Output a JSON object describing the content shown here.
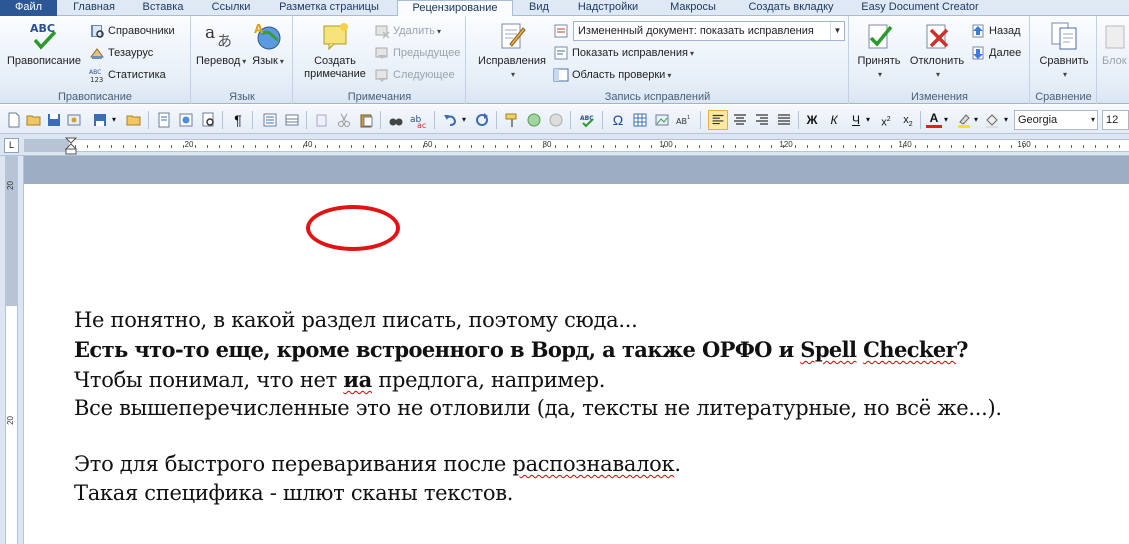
{
  "tabs": [
    "Файл",
    "Главная",
    "Вставка",
    "Ссылки",
    "Разметка страницы",
    "Рецензирование",
    "Вид",
    "Надстройки",
    "Макросы",
    "Создать вкладку",
    "Easy Document Creator"
  ],
  "ribbon": {
    "proofing": {
      "name": "Правописание",
      "spelling": "Правописание",
      "research": "Справочники",
      "thesaurus": "Тезаурус",
      "statistics": "Статистика"
    },
    "language": {
      "name": "Язык",
      "translate": "Перевод",
      "language": "Язык"
    },
    "comments": {
      "name": "Примечания",
      "new_comment": "Создать примечание",
      "new_comment_line1": "Создать",
      "new_comment_line2": "примечание",
      "delete": "Удалить",
      "previous": "Предыдущее",
      "next": "Следующее"
    },
    "tracking": {
      "name": "Запись исправлений",
      "track_changes": "Исправления",
      "display_mode": "Измененный документ: показать исправления",
      "show_markup": "Показать исправления",
      "reviewing_pane": "Область проверки"
    },
    "changes": {
      "name": "Изменения",
      "accept": "Принять",
      "reject": "Отклонить",
      "previous": "Назад",
      "next": "Далее"
    },
    "compare": {
      "name": "Сравнение",
      "compare": "Сравнить"
    },
    "protect": {
      "block_cut": "Блок"
    }
  },
  "toolbar": {
    "font_name": "Georgia",
    "font_size": "12",
    "bold": "Ж",
    "italic": "К",
    "underline": "Ч",
    "omega": "Ω",
    "pilcrow": "¶"
  },
  "ruler": {
    "h_labels": [
      "20",
      "40",
      "60",
      "80",
      "100",
      "120",
      "140",
      "160"
    ],
    "v_labels": [
      "20",
      "20"
    ]
  },
  "document": {
    "line1": "Не понятно, в какой раздел писать, поэтому сюда...",
    "line2_a": "Есть что-то еще, кроме встроенного в Ворд, а также ОРФО и ",
    "line2_b": "Spell",
    "line2_c": " ",
    "line2_d": "Checker",
    "line2_e": "?",
    "line3_a": "Чтобы понимал, что нет ",
    "line3_b": "иа",
    "line3_c": " предлога, например.",
    "line4": "Все вышеперечисленные это не отловили (да, тексты не литературные, но всё же...).",
    "line5_a": "Это для быстрого переваривания после ",
    "line5_b": "распознавалок",
    "line5_c": ".",
    "line6": "Такая специфика - шлют сканы текстов."
  },
  "colors": {
    "file_tab": "#2b5797",
    "highlight_ellipse": "#e01414",
    "spell_underline": "#dd0000"
  }
}
